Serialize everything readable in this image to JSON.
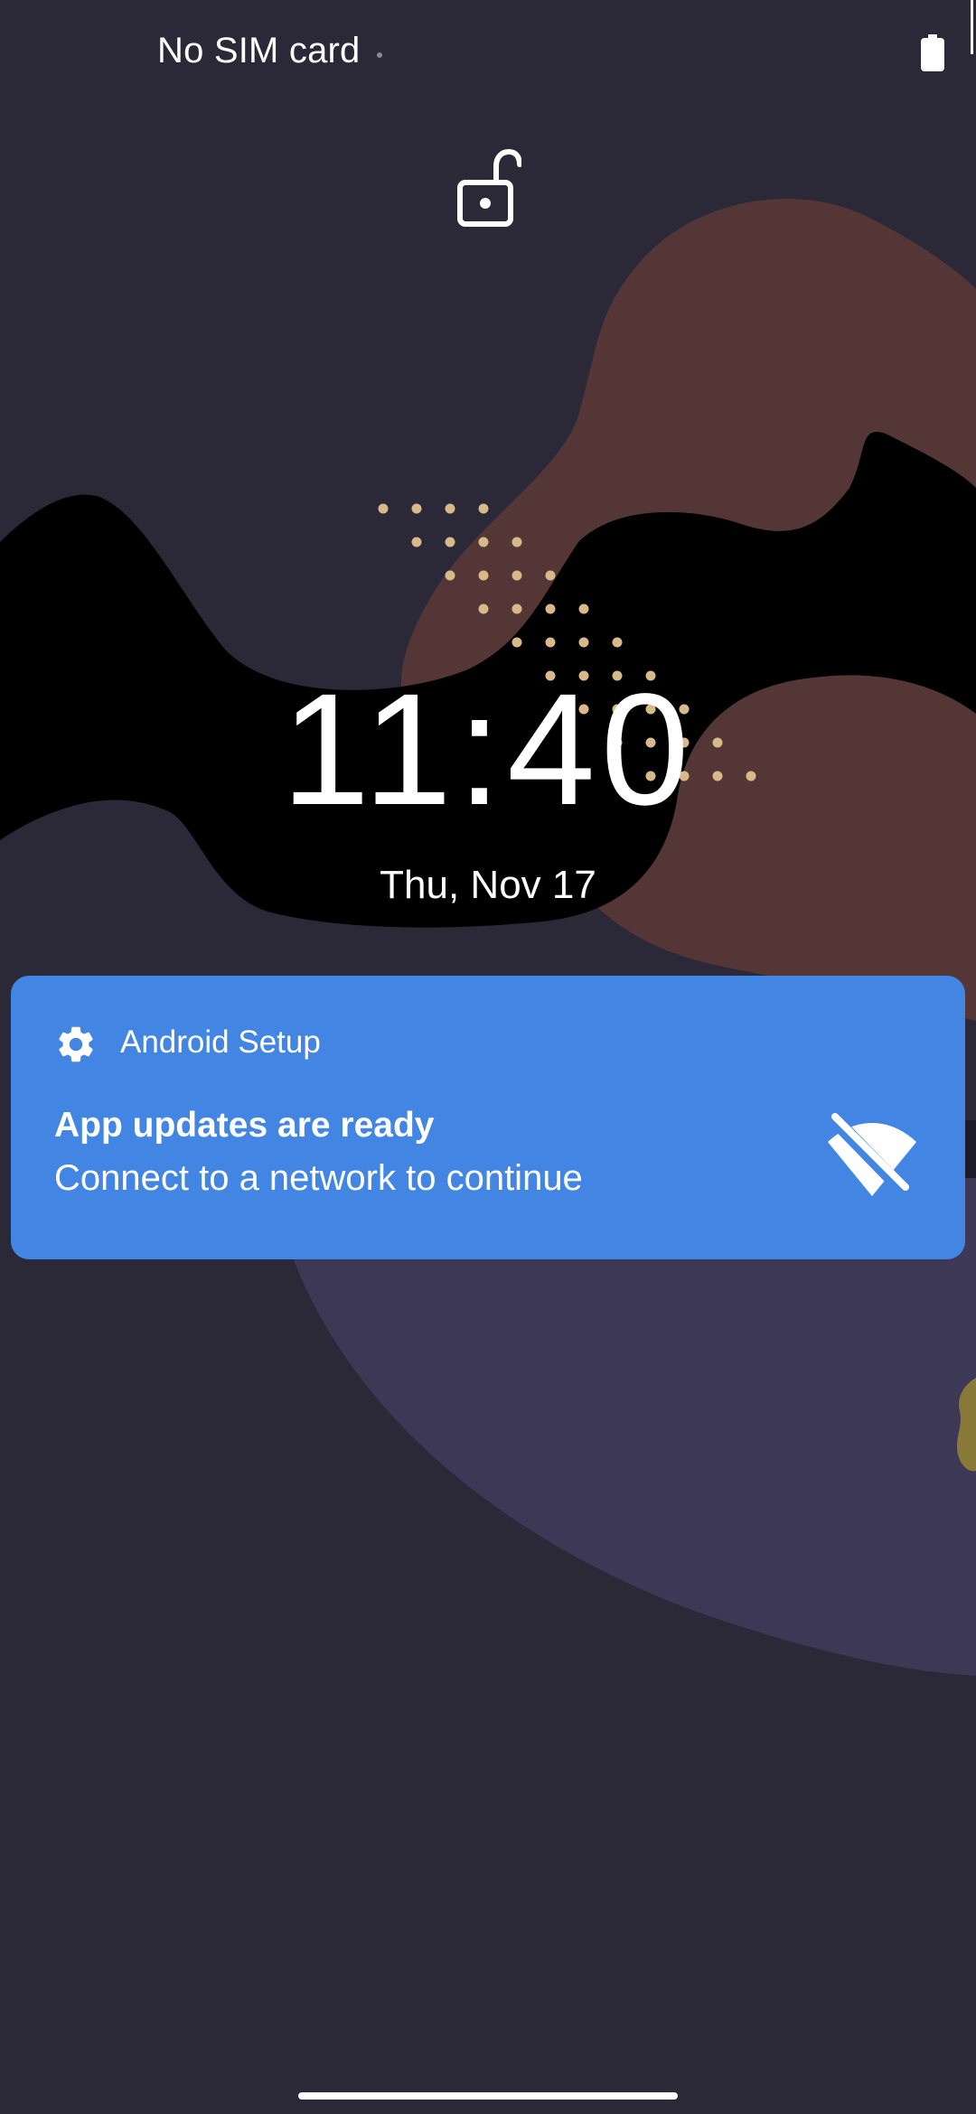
{
  "status_bar": {
    "carrier": "No SIM card",
    "battery_icon": "battery-full-icon"
  },
  "lock": {
    "icon": "unlocked-padlock-icon"
  },
  "clock": {
    "time": "11:40",
    "date": "Thu, Nov 17"
  },
  "notification": {
    "app_name": "Android Setup",
    "app_icon": "gear-icon",
    "title": "App updates are ready",
    "text": "Connect to a network to continue",
    "large_icon": "wifi-off-icon",
    "background_color": "#4285e2"
  },
  "colors": {
    "background": "#2b2838",
    "wave_black": "#000000",
    "wave_brown": "#543637",
    "wave_purple": "#3d3856",
    "dots": "#d8b98a"
  }
}
